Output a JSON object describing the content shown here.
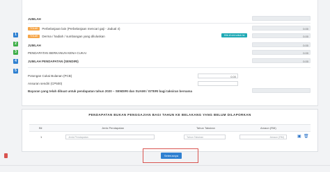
{
  "sidebar": {
    "steps": [
      {
        "label": "1",
        "color": "#2f80d1"
      },
      {
        "label": "2",
        "color": "#3fae49"
      },
      {
        "label": "3",
        "color": "#3fae49"
      },
      {
        "label": "4",
        "color": "#2f80d1"
      },
      {
        "label": "5",
        "color": "#2f80d1"
      }
    ]
  },
  "income": {
    "jumlah_top": "JUMLAH",
    "row_4_pill": "TOLAK",
    "row_4_label": "Perbelanjaan lain (Perbelanjaan mencari gaji - Jadual 4)",
    "row_4_value": "0.00",
    "row_5_pill": "TOLAK",
    "row_5_label": "Derma / hadiah / sumbangan yang diluluskan",
    "row_5_button": "Klik di sini untuk isi",
    "row_5_value": "0.00",
    "jumlah": "JUMLAH",
    "jumlah_value": "0.00",
    "pendapatan_cukai": "PENDAPATAN BERKANUN KENA CUKAI",
    "pendapatan_cukai_value": "0.00",
    "jumlah_sendiri": "JUMLAH PENDAPATAN (SENDIRI)",
    "jumlah_sendiri_value": "0.00"
  },
  "deductions": {
    "pcb_label": "Potongan Cukai Bulanan (PCB)",
    "pcb_value": "0.00",
    "cp500_label": "Ansuran sendiri (CP500)",
    "bayaran_label": "Bayaran yang telah dibuat untuk pendapatan tahun 2020 – SENDIRI dan SUAMI / ISTERI bagi taksiran bersama"
  },
  "arrears": {
    "title": "PENDAPATAN BUKAN PENGGAJIAN BAGI TAHUN KE BELAKANG YANG BELUM DILAPORKAN",
    "col_bil": "Bil",
    "col_jenis": "Jenis Pendapatan",
    "col_tahun": "Tahun Taksiran",
    "col_amaun": "Amaun (RM)",
    "row_no": "1",
    "row_jenis_placeholder": "Jenis Pendapatan",
    "row_tahun_placeholder": "Tahun Taksiran",
    "row_amaun_placeholder": "Amaun (RM)"
  },
  "actions": {
    "submit_label": "Seterusnya"
  }
}
